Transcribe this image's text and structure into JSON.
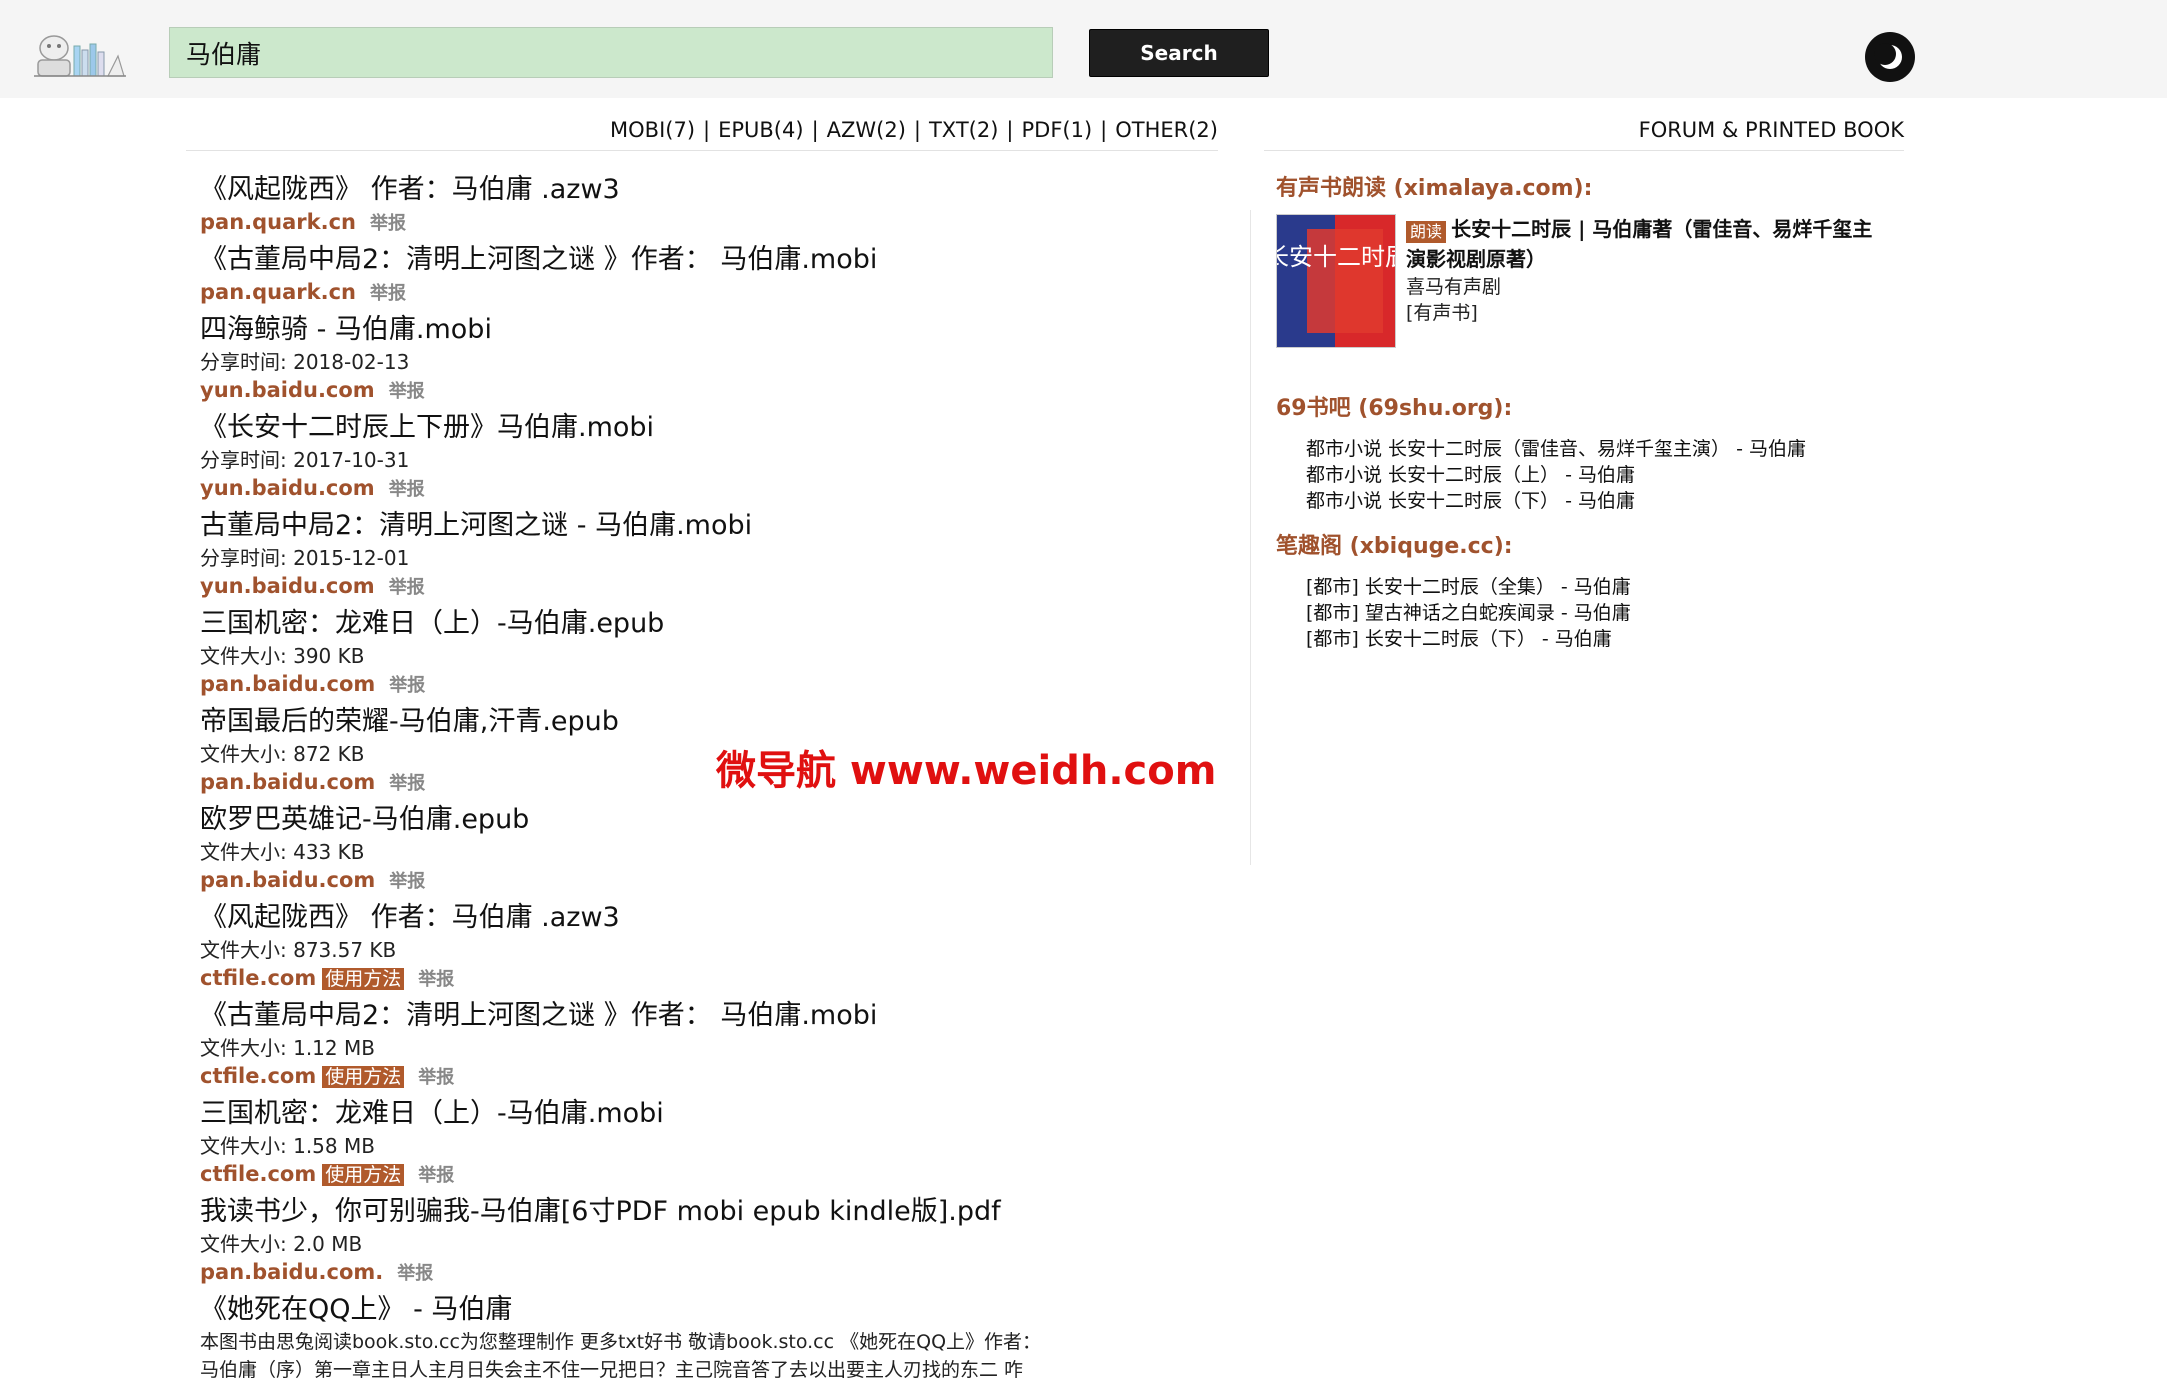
{
  "search": {
    "value": "马伯庸",
    "button_label": "Search"
  },
  "format_nav": [
    {
      "label": "MOBI(7)"
    },
    {
      "label": "EPUB(4)"
    },
    {
      "label": "AZW(2)"
    },
    {
      "label": "TXT(2)"
    },
    {
      "label": "PDF(1)"
    },
    {
      "label": "OTHER(2)"
    }
  ],
  "forum_label": "FORUM & PRINTED BOOK",
  "report_label": "举报",
  "usage_label": "使用方法",
  "results": [
    {
      "title": "《风起陇西》 作者：马伯庸 .azw3",
      "meta": "",
      "source": "pan.quark.cn",
      "usage": false
    },
    {
      "title": "《古董局中局2：清明上河图之谜 》作者： 马伯庸.mobi",
      "meta": "",
      "source": "pan.quark.cn",
      "usage": false
    },
    {
      "title": "四海鲸骑 - 马伯庸.mobi",
      "meta": "分享时间: 2018-02-13",
      "source": "yun.baidu.com",
      "usage": false
    },
    {
      "title": "《长安十二时辰上下册》马伯庸.mobi",
      "meta": "分享时间: 2017-10-31",
      "source": "yun.baidu.com",
      "usage": false
    },
    {
      "title": "古董局中局2：清明上河图之谜 - 马伯庸.mobi",
      "meta": "分享时间: 2015-12-01",
      "source": "yun.baidu.com",
      "usage": false
    },
    {
      "title": "三国机密：龙难日（上）-马伯庸.epub",
      "meta": "文件大小: 390 KB",
      "source": "pan.baidu.com",
      "usage": false
    },
    {
      "title": "帝国最后的荣耀-马伯庸,汗青.epub",
      "meta": "文件大小: 872 KB",
      "source": "pan.baidu.com",
      "usage": false
    },
    {
      "title": "欧罗巴英雄记-马伯庸.epub",
      "meta": "文件大小: 433 KB",
      "source": "pan.baidu.com",
      "usage": false
    },
    {
      "title": "《风起陇西》 作者：马伯庸 .azw3",
      "meta": "文件大小: 873.57 KB",
      "source": "ctfile.com",
      "usage": true
    },
    {
      "title": "《古董局中局2：清明上河图之谜 》作者： 马伯庸.mobi",
      "meta": "文件大小: 1.12 MB",
      "source": "ctfile.com",
      "usage": true
    },
    {
      "title": "三国机密：龙难日（上）-马伯庸.mobi",
      "meta": "文件大小: 1.58 MB",
      "source": "ctfile.com",
      "usage": true
    },
    {
      "title": "我读书少，你可别骗我-马伯庸[6寸PDF mobi epub kindle版].pdf",
      "meta": "文件大小: 2.0 MB",
      "source": "pan.baidu.com.",
      "usage": false
    },
    {
      "title": "《她死在QQ上》 - 马伯庸",
      "meta": "",
      "source": "",
      "usage": false,
      "desc": "本图书由思兔阅读book.sto.cc为您整理制作 更多txt好书 敬请book.sto.cc 《她死在QQ上》作者：",
      "desc2": "马伯庸（序）第一章主日人主月日失会主不住一兄把日？主己院音答了去以出要主人刃找的东二 咋"
    }
  ],
  "watermark": "微导航 www.weidh.com",
  "sidebar": {
    "audio_heading": "有声书朗读 (ximalaya.com):",
    "audio": {
      "badge": "朗读",
      "title": "长安十二时辰 | 马伯庸著（雷佳音、易烊千玺主演影视剧原著）",
      "publisher": "喜马有声剧",
      "tag": "[有声书]",
      "cover_text": "长安十二时辰"
    },
    "shu69_heading": "69书吧 (69shu.org):",
    "shu69_items": [
      "都市小说 长安十二时辰（雷佳音、易烊千玺主演） - 马伯庸",
      "都市小说 长安十二时辰（上） - 马伯庸",
      "都市小说 长安十二时辰（下） - 马伯庸"
    ],
    "biquge_heading": "笔趣阁 (xbiquge.cc):",
    "biquge_items": [
      "[都市] 长安十二时辰（全集） - 马伯庸",
      "[都市] 望古神话之白蛇疾闻录 - 马伯庸",
      "[都市] 长安十二时辰（下） - 马伯庸"
    ]
  },
  "colors": {
    "source": "#a0522d",
    "badge": "#b05a2c",
    "watermark": "#e01010",
    "search_bg": "#cce8cc"
  }
}
